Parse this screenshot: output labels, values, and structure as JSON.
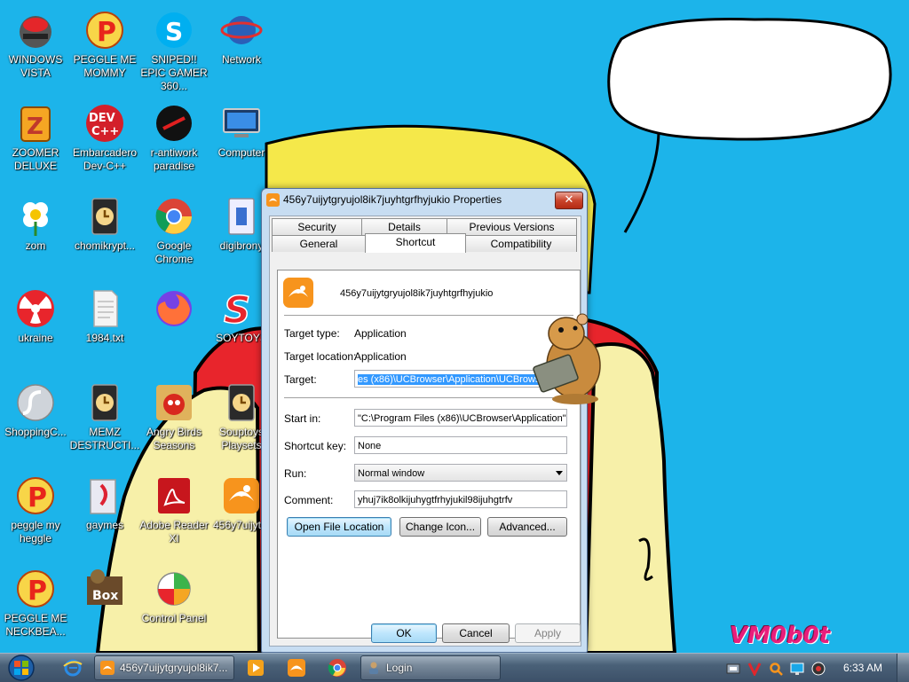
{
  "wallpaper": {
    "speech_bubble_text": "",
    "watermark": "VM0b0t"
  },
  "desktop_icons": [
    {
      "label": "WINDOWS VISTA",
      "icon": "robot-icon"
    },
    {
      "label": "PEGGLE ME MOMMY",
      "icon": "peggle-icon"
    },
    {
      "label": "SNIPED!! EPIC GAMER 360...",
      "icon": "skype-icon"
    },
    {
      "label": "Network",
      "icon": "network-icon"
    },
    {
      "label": "ZOOMER DELUXE",
      "icon": "zoomer-icon"
    },
    {
      "label": "Embarcadero Dev-C++",
      "icon": "devcpp-icon"
    },
    {
      "label": "r-antiwork paradise",
      "icon": "antiwork-icon"
    },
    {
      "label": "Computer",
      "icon": "computer-icon"
    },
    {
      "label": "zom",
      "icon": "flower-icon"
    },
    {
      "label": "chomikrypt...",
      "icon": "clock-file-icon"
    },
    {
      "label": "Google Chrome",
      "icon": "chrome-icon"
    },
    {
      "label": "digibrony",
      "icon": "installer-icon"
    },
    {
      "label": "ukraine",
      "icon": "radiation-icon"
    },
    {
      "label": "1984.txt",
      "icon": "text-file-icon"
    },
    {
      "label": "",
      "icon": "firefox-icon"
    },
    {
      "label": "SOYTOYS",
      "icon": "soytoys-icon"
    },
    {
      "label": "ShoppingC...",
      "icon": "flash-icon"
    },
    {
      "label": "MEMZ DESTRUCTI...",
      "icon": "clock-file-icon"
    },
    {
      "label": "Angry Birds Seasons",
      "icon": "angry-birds-icon"
    },
    {
      "label": "Souptoys Playsets",
      "icon": "clock-file-icon"
    },
    {
      "label": "peggle my heggle",
      "icon": "peggle-icon"
    },
    {
      "label": "gaymes",
      "icon": "games-folder-icon"
    },
    {
      "label": "Adobe Reader XI",
      "icon": "adobe-reader-icon"
    },
    {
      "label": "456y7uijyt...",
      "icon": "ucbrowser-icon"
    },
    {
      "label": "PEGGLE ME NECKBEA...",
      "icon": "peggle-icon"
    },
    {
      "label": "",
      "icon": "box-icon"
    },
    {
      "label": "Control Panel",
      "icon": "control-panel-icon"
    }
  ],
  "dialog": {
    "title": "456y7uijytgryujol8ik7juyhtgrfhyjukio Properties",
    "close_label": "✕",
    "tabs_row1": [
      "Security",
      "Details",
      "Previous Versions"
    ],
    "tabs_row2": [
      "General",
      "Shortcut",
      "Compatibility"
    ],
    "active_tab": "Shortcut",
    "shortcut_name": "456y7uijytgryujol8ik7juyhtgrfhyjukio",
    "target_type_label": "Target type:",
    "target_type_value": "Application",
    "target_location_label": "Target location:",
    "target_location_value": "Application",
    "target_label": "Target:",
    "target_value": "es (x86)\\UCBrowser\\Application\\UCBrowser.exe\"",
    "start_in_label": "Start in:",
    "start_in_value": "\"C:\\Program Files (x86)\\UCBrowser\\Application\"",
    "shortcut_key_label": "Shortcut key:",
    "shortcut_key_value": "None",
    "run_label": "Run:",
    "run_value": "Normal window",
    "comment_label": "Comment:",
    "comment_value": "yhuj7ik8olkijuhygtfrhyjukil98ijuhgtrfv",
    "open_file_location": "Open File Location",
    "change_icon": "Change Icon...",
    "advanced": "Advanced...",
    "ok": "OK",
    "cancel": "Cancel",
    "apply": "Apply"
  },
  "taskbar": {
    "tasks": [
      {
        "label": "456y7uijytgryujol8ik7...",
        "icon": "ucbrowser-icon"
      },
      {
        "label": "Login",
        "icon": "login-icon"
      }
    ],
    "pinned": [
      "internet-explorer-icon",
      "media-player-icon",
      "ucbrowser-icon",
      "chrome-icon"
    ],
    "tray": [
      "network-tray-icon",
      "v-tray-icon",
      "search-tray-icon",
      "monitor-tray-icon",
      "volume-tray-icon"
    ],
    "clock": "6:33 AM"
  },
  "colors": {
    "desktop_bg": "#1cb4ea",
    "bubble_text": "#e8243a",
    "watermark": "#e81e7c",
    "selection": "#3399ff"
  }
}
